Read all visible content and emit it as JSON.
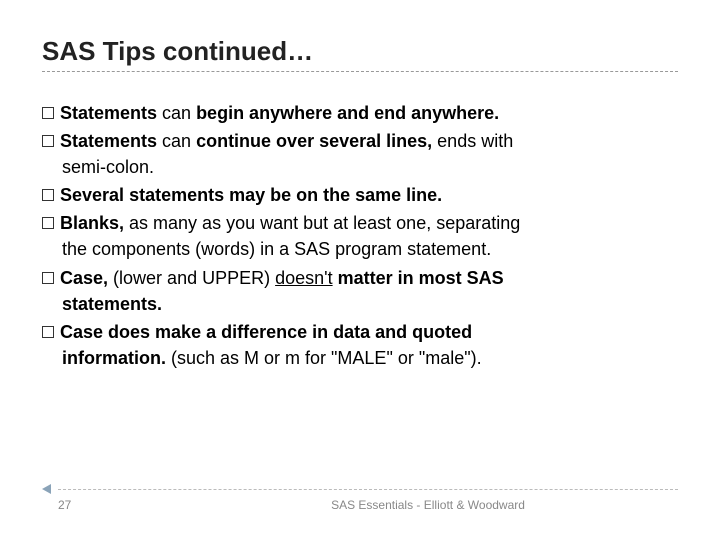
{
  "title": "SAS Tips continued…",
  "bullets": {
    "b1_lead": "Statements",
    "b1_rest": " can ",
    "b1_bold": "begin anywhere and end anywhere.",
    "b2_lead": "Statements",
    "b2_rest": " can ",
    "b2_bold": "continue over several lines,",
    "b2_tail": " ends with",
    "b2_cont": "semi‑colon.",
    "b3_lead": "Several",
    "b3_bold": " statements may be on the same line.",
    "b4_lead": "Blanks,",
    "b4_rest": " as many as you want but at least one, separating",
    "b4_cont": "the components (words) in a SAS program statement.",
    "b5_lead": "Case,",
    "b5_rest": " (lower and UPPER) ",
    "b5_u": "doesn't",
    "b5_bold": " matter in most SAS",
    "b5_cont": "statements.",
    "b6_lead": "Case",
    "b6_bold1": " does make a difference in data and quoted",
    "b6_cont": "information.",
    "b6_tail": " (such as M or m for \"MALE\" or \"male\")."
  },
  "footer": {
    "page": "27",
    "source": "SAS Essentials - Elliott & Woodward"
  }
}
